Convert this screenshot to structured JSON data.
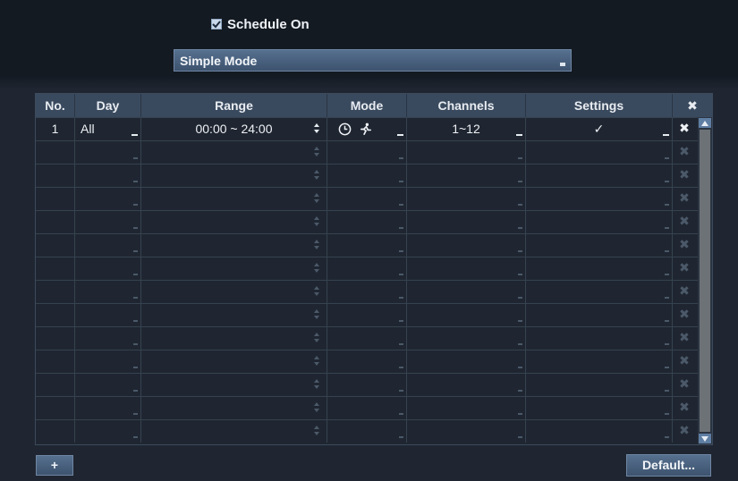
{
  "schedule_on": {
    "label": "Schedule On",
    "checked": true
  },
  "mode_select": {
    "value": "Simple Mode"
  },
  "table": {
    "headers": {
      "no": "No.",
      "day": "Day",
      "range": "Range",
      "mode": "Mode",
      "channels": "Channels",
      "settings": "Settings",
      "delete_all": "✖"
    },
    "rows": [
      {
        "no": "1",
        "day": "All",
        "range": "00:00 ~ 24:00",
        "mode_icons": [
          "clock-icon",
          "running-man-icon"
        ],
        "channels": "1~12",
        "settings": "✓",
        "delete": "✖"
      }
    ],
    "empty_row_count": 13,
    "empty_row_delete": "✖"
  },
  "buttons": {
    "add": "+",
    "default": "Default..."
  },
  "colors": {
    "accent": "#4a6485",
    "header": "#3a4a5e",
    "background": "#1f2631"
  }
}
